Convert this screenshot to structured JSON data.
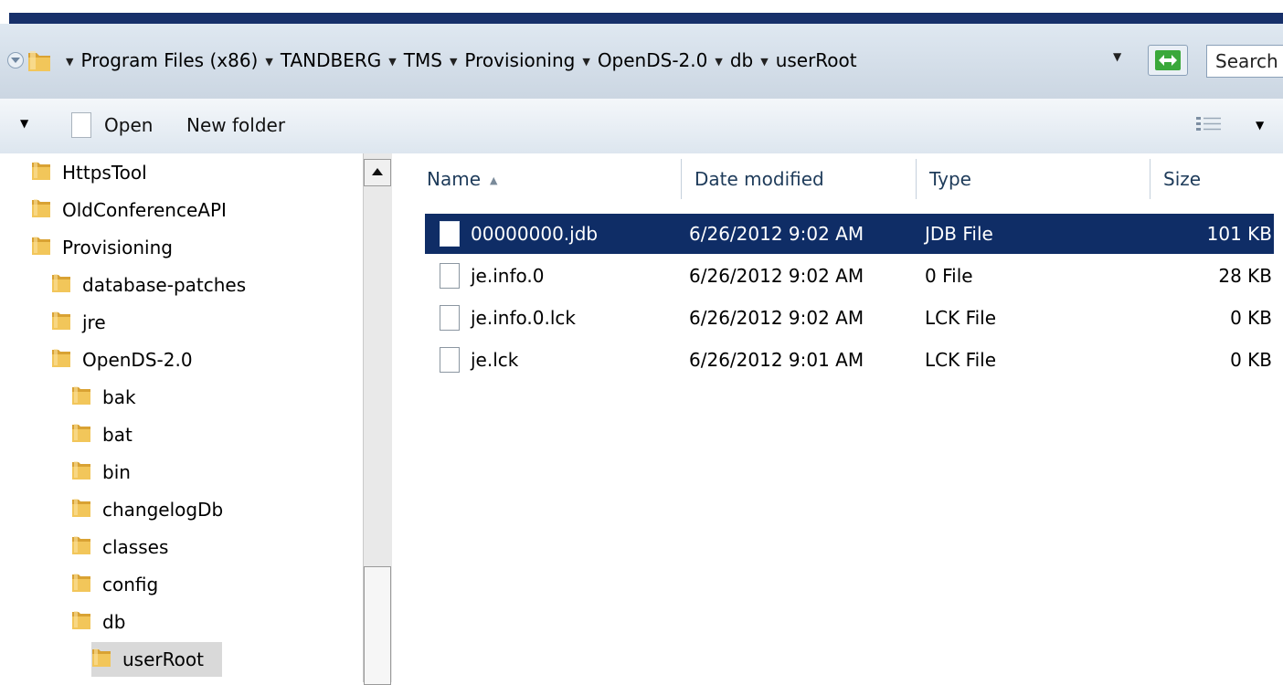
{
  "address": {
    "breadcrumbs": [
      "Program Files (x86)",
      "TANDBERG",
      "TMS",
      "Provisioning",
      "OpenDS-2.0",
      "db",
      "userRoot"
    ],
    "search_text": "Search"
  },
  "toolbar": {
    "open_label": "Open",
    "new_folder_label": "New folder"
  },
  "tree": {
    "items": [
      {
        "label": "HttpsTool",
        "level": 0
      },
      {
        "label": "OldConferenceAPI",
        "level": 0
      },
      {
        "label": "Provisioning",
        "level": 0
      },
      {
        "label": "database-patches",
        "level": 1
      },
      {
        "label": "jre",
        "level": 1
      },
      {
        "label": "OpenDS-2.0",
        "level": 1
      },
      {
        "label": "bak",
        "level": 2
      },
      {
        "label": "bat",
        "level": 2
      },
      {
        "label": "bin",
        "level": 2
      },
      {
        "label": "changelogDb",
        "level": 2
      },
      {
        "label": "classes",
        "level": 2
      },
      {
        "label": "config",
        "level": 2
      },
      {
        "label": "db",
        "level": 2
      },
      {
        "label": "userRoot",
        "level": 3,
        "selected": true
      }
    ]
  },
  "columns": [
    "Name",
    "Date modified",
    "Type",
    "Size"
  ],
  "files": [
    {
      "name": "00000000.jdb",
      "date": "6/26/2012 9:02 AM",
      "type": "JDB File",
      "size": "101 KB",
      "selected": true
    },
    {
      "name": "je.info.0",
      "date": "6/26/2012 9:02 AM",
      "type": "0 File",
      "size": "28 KB"
    },
    {
      "name": "je.info.0.lck",
      "date": "6/26/2012 9:02 AM",
      "type": "LCK File",
      "size": "0 KB"
    },
    {
      "name": "je.lck",
      "date": "6/26/2012 9:01 AM",
      "type": "LCK File",
      "size": "0 KB"
    }
  ],
  "colors": {
    "title_bar": "#17306a",
    "selection": "#0f2d66",
    "folder": "#e8b84a",
    "tree_selected": "#d9d9d9"
  },
  "icons": {
    "nav": "chevron-down-icon",
    "folder": "folder-icon",
    "refresh": "refresh-icon",
    "view": "view-options-icon",
    "file": "file-icon"
  }
}
